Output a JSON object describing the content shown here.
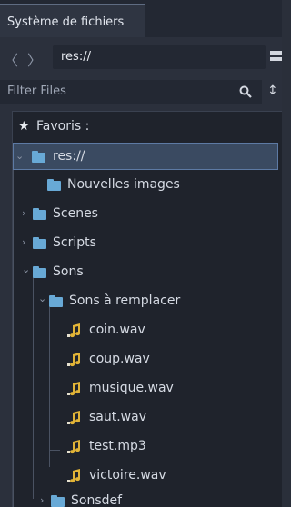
{
  "dock": {
    "tab_title": "Système de fichiers"
  },
  "pathbar": {
    "back_icon": "chevron-left-icon",
    "forward_icon": "chevron-right-icon",
    "back_glyph": "〈",
    "forward_glyph": "〉",
    "path": "res://"
  },
  "filter": {
    "placeholder": "Filter Files",
    "search_icon": "search-icon",
    "sort_icon": "sort-icon",
    "sort_glyph": "↕"
  },
  "tree": {
    "favorites_label": "Favoris :",
    "star_glyph": "★",
    "root_label": "res://",
    "items": [
      {
        "label": "Nouvelles images",
        "type": "folder"
      },
      {
        "label": "Scenes",
        "type": "folder"
      },
      {
        "label": "Scripts",
        "type": "folder"
      },
      {
        "label": "Sons",
        "type": "folder"
      },
      {
        "label": "Sons à remplacer",
        "type": "folder"
      },
      {
        "label": "coin.wav",
        "type": "audio"
      },
      {
        "label": "coup.wav",
        "type": "audio"
      },
      {
        "label": "musique.wav",
        "type": "audio"
      },
      {
        "label": "saut.wav",
        "type": "audio"
      },
      {
        "label": "test.mp3",
        "type": "audio"
      },
      {
        "label": "victoire.wav",
        "type": "audio"
      },
      {
        "label": "Sonsdef",
        "type": "folder"
      }
    ]
  },
  "colors": {
    "folder": "#68a9d6",
    "audio_note": "#e2b437",
    "selection": "#3a4a61"
  }
}
